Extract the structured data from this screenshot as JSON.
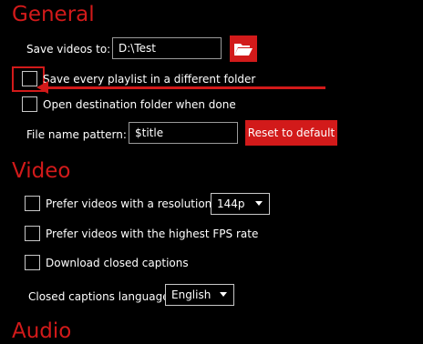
{
  "general": {
    "title": "General",
    "save_videos_label": "Save videos to:",
    "save_path_value": "D:\\Test",
    "browse_icon": "folder-open-icon",
    "save_playlist_label": "Save every playlist in a different folder",
    "open_dest_label": "Open destination folder when done",
    "file_name_pattern_label": "File name pattern:",
    "file_name_pattern_value": "$title",
    "reset_button_label": "Reset to default"
  },
  "video": {
    "title": "Video",
    "prefer_resolution_label": "Prefer videos with a resolution of",
    "resolution_selected": "144p",
    "prefer_fps_label": "Prefer videos with the highest FPS rate",
    "download_captions_label": "Download closed captions",
    "captions_language_label": "Closed captions language:",
    "captions_language_selected": "English"
  },
  "audio": {
    "title": "Audio"
  },
  "colors": {
    "accent": "#d21a1a",
    "background": "#000000",
    "text": "#ffffff"
  }
}
